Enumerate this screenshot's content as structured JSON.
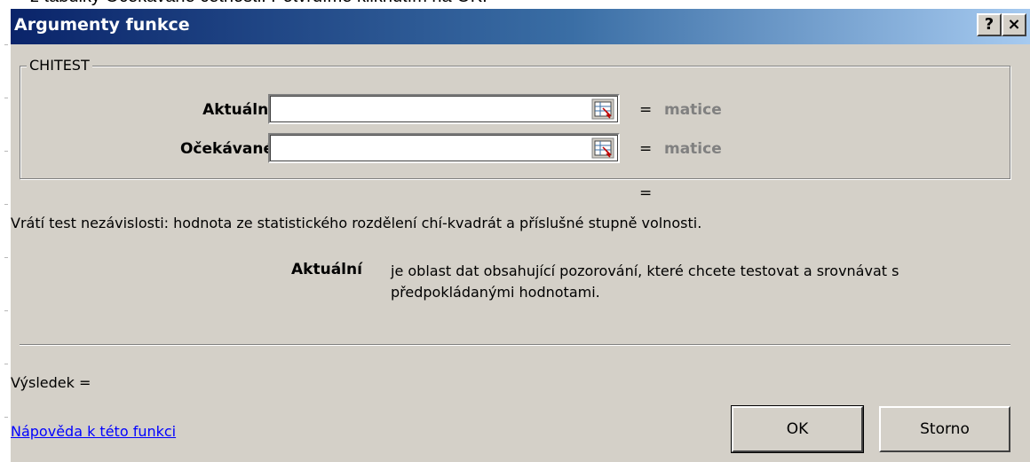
{
  "document": {
    "background_text": "z tabulky Očekávané četnosti. Potvrdíme kliknutím na OK."
  },
  "dialog": {
    "title": "Argumenty funkce",
    "help_button": "?",
    "close_button": "×",
    "function_name": "CHITEST",
    "arguments": [
      {
        "label": "Aktuální",
        "value": "",
        "result": "matice"
      },
      {
        "label": "Očekávané",
        "value": "",
        "result": "matice"
      }
    ],
    "equals_sign": "=",
    "formula_result_equals": "=",
    "description": "Vrátí test nezávislosti: hodnota ze statistického rozdělení chí-kvadrát a příslušné stupně volnosti.",
    "argument_help": {
      "label": "Aktuální",
      "text": "je oblast dat obsahující pozorování, které chcete testovat a srovnávat s předpokládanými hodnotami."
    },
    "result_label": "Výsledek =",
    "help_link": "Nápověda k této funkci",
    "ok_label": "OK",
    "cancel_label": "Storno"
  },
  "colors": {
    "title_gradient_start": "#0a246a",
    "title_gradient_end": "#a6caf0",
    "dialog_face": "#d4d0c8",
    "result_gray": "#808080",
    "link_blue": "#0000ff"
  }
}
